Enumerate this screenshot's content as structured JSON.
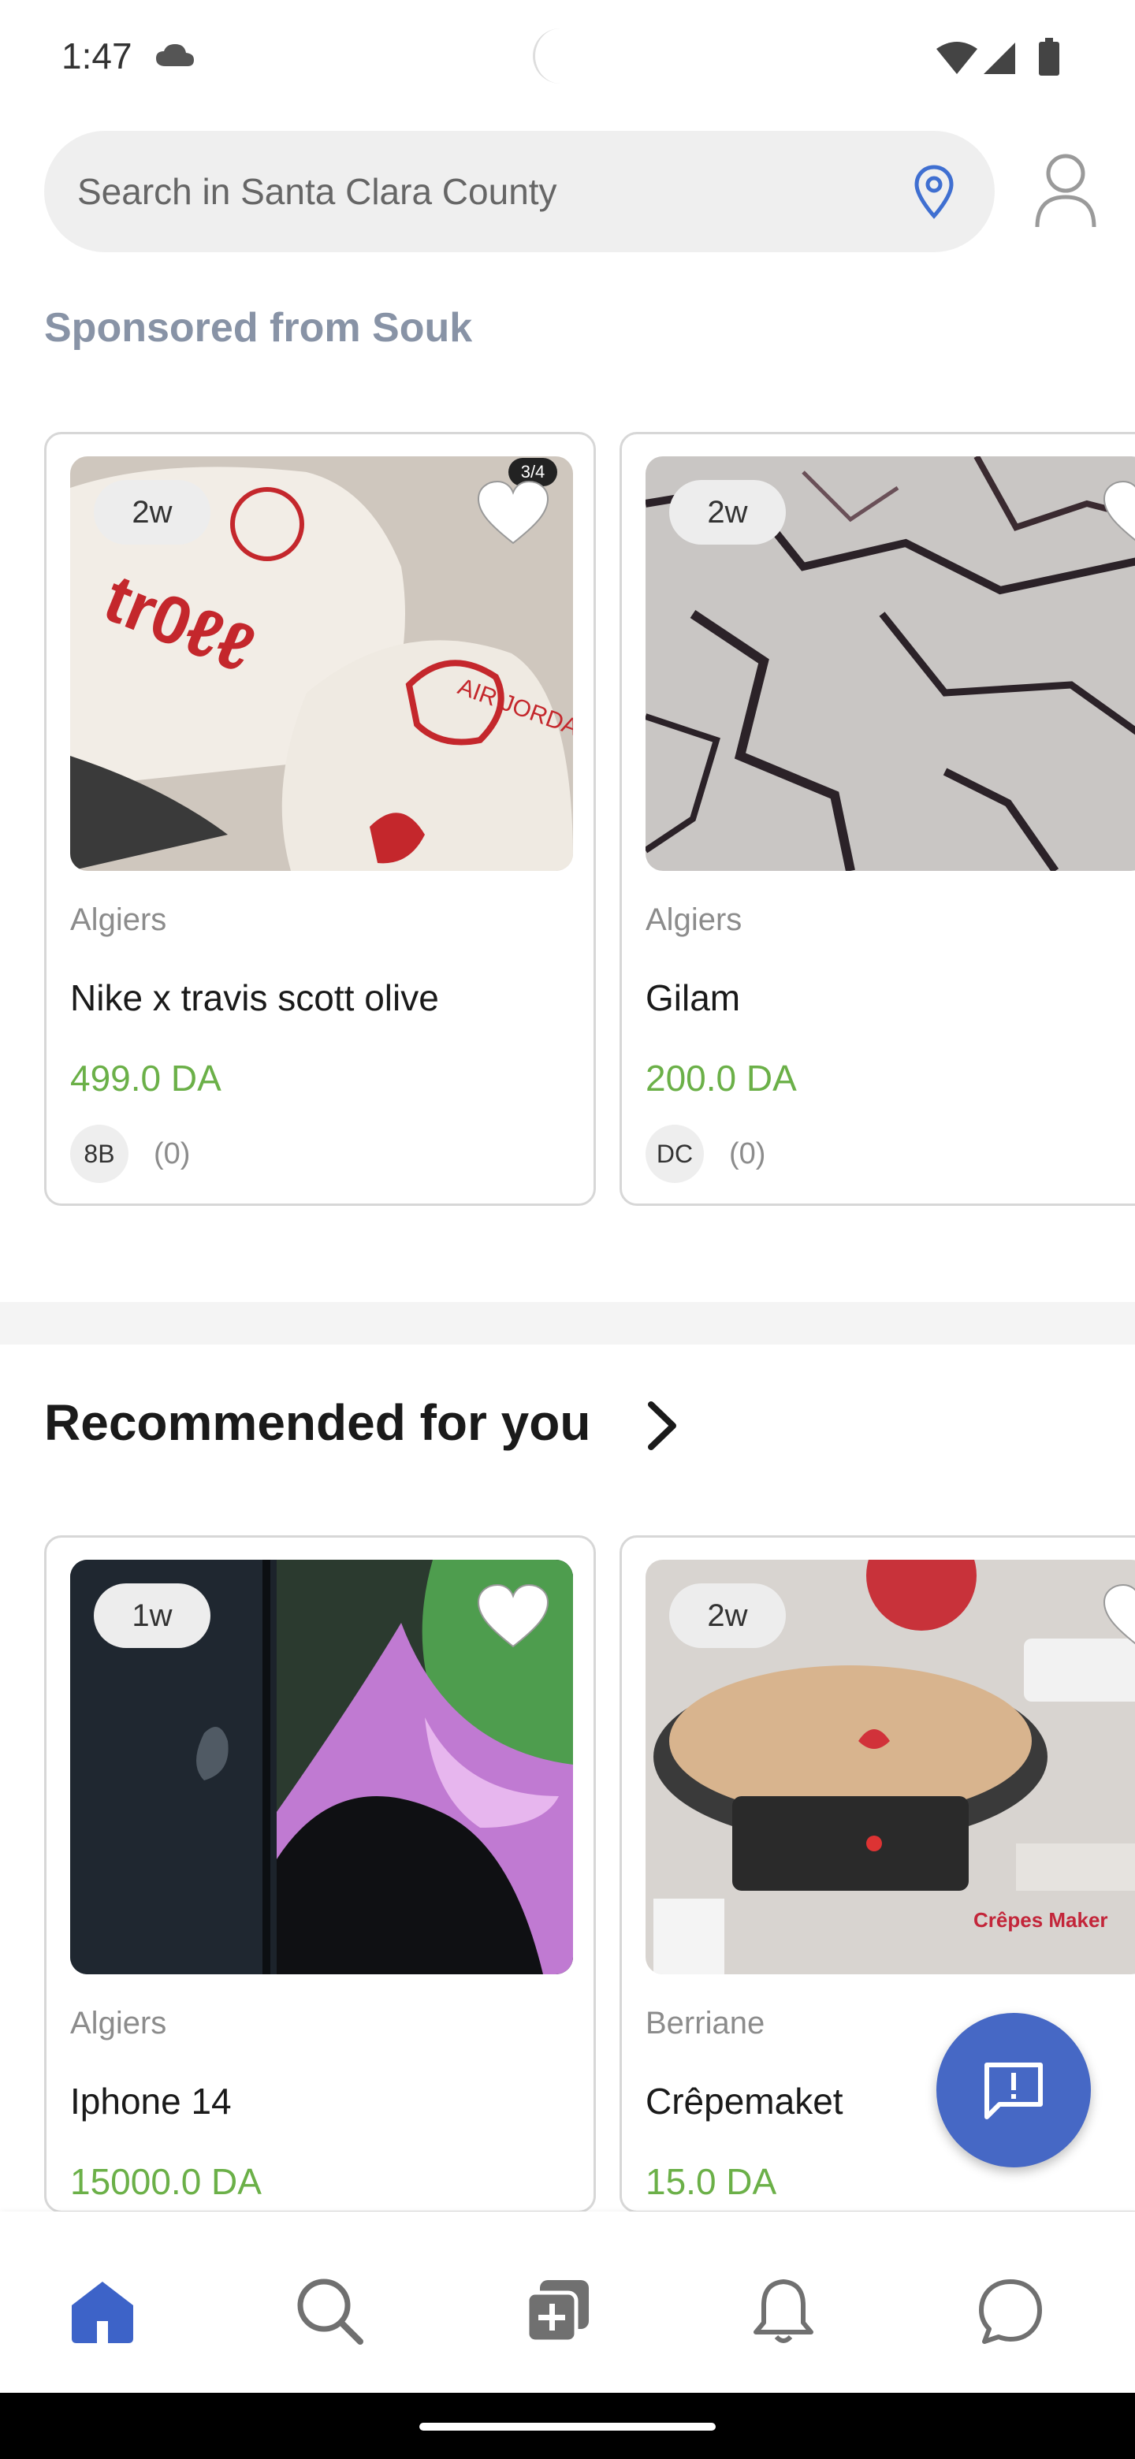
{
  "status_bar": {
    "time": "1:47"
  },
  "search": {
    "placeholder": "Search in Santa Clara County"
  },
  "sponsored": {
    "title": "Sponsored from Souk",
    "items": [
      {
        "age": "2w",
        "photo_counter": "3/4",
        "location": "Algiers",
        "title": "Nike x travis scott olive",
        "price": "499.0 DA",
        "seller_initials": "8B",
        "rating": "(0)"
      },
      {
        "age": "2w",
        "location": "Algiers",
        "title": "Gilam",
        "price": "200.0 DA",
        "seller_initials": "DC",
        "rating": "(0)"
      }
    ]
  },
  "recommended": {
    "title": "Recommended for you",
    "items": [
      {
        "age": "1w",
        "location": "Algiers",
        "title": "Iphone 14",
        "price": "15000.0 DA"
      },
      {
        "age": "2w",
        "location": "Berriane",
        "title": "Crêpemaket",
        "price": "15.0 DA",
        "image_text": "Crêpes Maker"
      }
    ]
  },
  "nav": [
    "home-icon",
    "search-icon",
    "add-listing-icon",
    "bell-icon",
    "chat-icon"
  ],
  "colors": {
    "accent": "#4668c5",
    "price": "#6bb048",
    "sponsored": "#8893a6"
  }
}
